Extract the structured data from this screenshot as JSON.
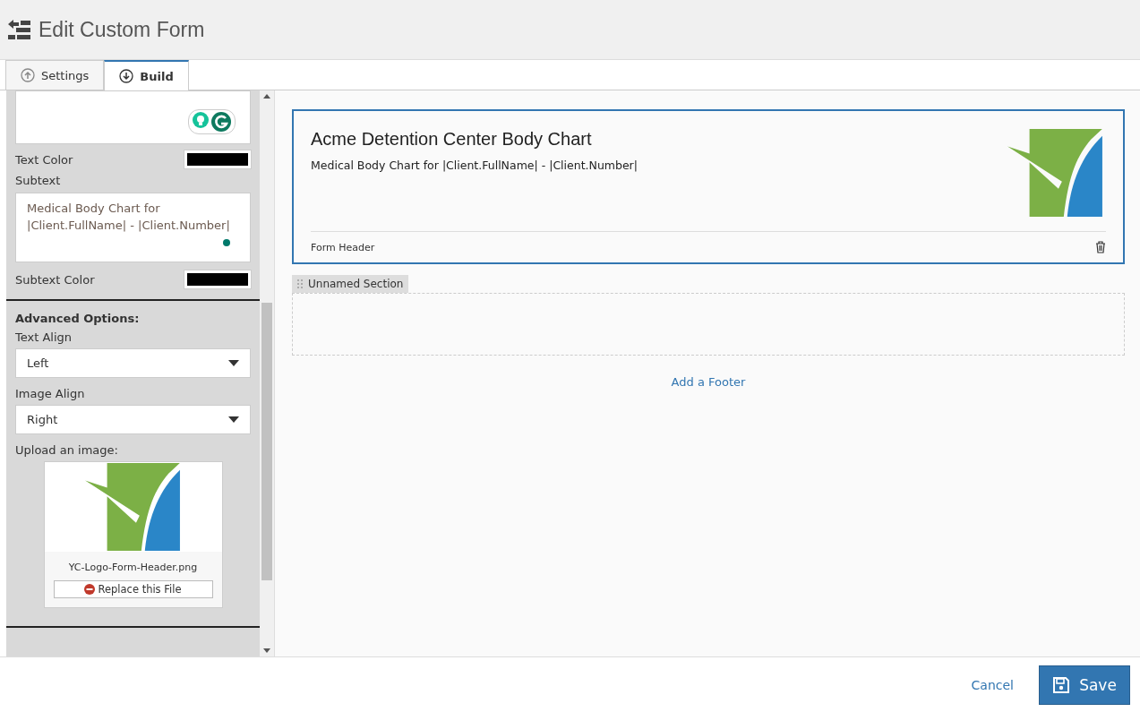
{
  "page": {
    "title": "Edit Custom Form"
  },
  "tabs": [
    {
      "label": "Settings",
      "kind": "up",
      "selected": false
    },
    {
      "label": "Build",
      "kind": "down",
      "selected": true
    }
  ],
  "side_panel": {
    "text_color_label": "Text Color",
    "subtext_label": "Subtext",
    "subtext_value": "Medical Body Chart for |Client.FullName| - |Client.Number|",
    "subtext_color_label": "Subtext Color",
    "advanced_title": "Advanced Options:",
    "selects": [
      {
        "label": "Text Align",
        "value": "Left"
      },
      {
        "label": "Image Align",
        "value": "Right"
      }
    ],
    "upload_label": "Upload an image:",
    "file_name": "YC-Logo-Form-Header.png",
    "replace_button": "Replace this File"
  },
  "form_header": {
    "title": "Acme Detention Center Body Chart",
    "subtext": "Medical Body Chart for |Client.FullName| - |Client.Number|",
    "label": "Form Header"
  },
  "section": {
    "name": "Unnamed Section"
  },
  "add_footer": "Add a Footer",
  "footer": {
    "cancel": "Cancel",
    "save": "Save"
  }
}
